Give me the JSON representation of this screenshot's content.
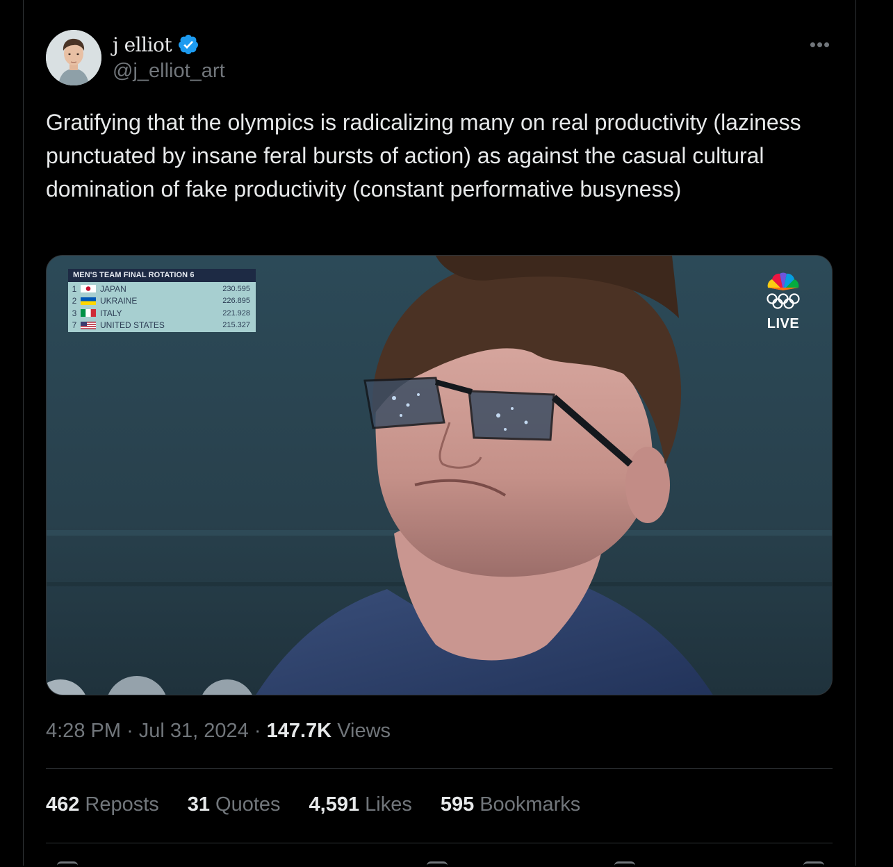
{
  "author": {
    "display_name": "j elliot",
    "handle": "@j_elliot_art",
    "verified_icon": "verified-badge-icon"
  },
  "more_icon": "more-horizontal-icon",
  "tweet": {
    "text": "Gratifying that the olympics is radicalizing many on real productivity (laziness punctuated by insane feral bursts of action) as against the casual cultural domination of fake productivity (constant performative busyness)"
  },
  "media": {
    "scoreboard": {
      "title": "MEN'S TEAM FINAL  ROTATION 6",
      "rows": [
        {
          "rank": "1",
          "country": "JAPAN",
          "score": "230.595",
          "flag": "japan-flag-icon"
        },
        {
          "rank": "2",
          "country": "UKRAINE",
          "score": "226.895",
          "flag": "ukraine-flag-icon"
        },
        {
          "rank": "3",
          "country": "ITALY",
          "score": "221.928",
          "flag": "italy-flag-icon"
        },
        {
          "rank": "7",
          "country": "UNITED STATES",
          "score": "215.327",
          "flag": "usa-flag-icon"
        }
      ]
    },
    "network": {
      "logo": "peacock-olympic-rings-logo",
      "live_label": "LIVE"
    }
  },
  "meta": {
    "time": "4:28 PM",
    "separator": "·",
    "date": "Jul 31, 2024",
    "views_count": "147.7K",
    "views_label": "Views"
  },
  "stats": [
    {
      "count": "462",
      "label": "Reposts"
    },
    {
      "count": "31",
      "label": "Quotes"
    },
    {
      "count": "4,591",
      "label": "Likes"
    },
    {
      "count": "595",
      "label": "Bookmarks"
    }
  ],
  "colors": {
    "background": "#000000",
    "text_primary": "#e7e9ea",
    "text_secondary": "#71767b",
    "verified_blue": "#1d9bf0",
    "border": "#2f3336"
  }
}
